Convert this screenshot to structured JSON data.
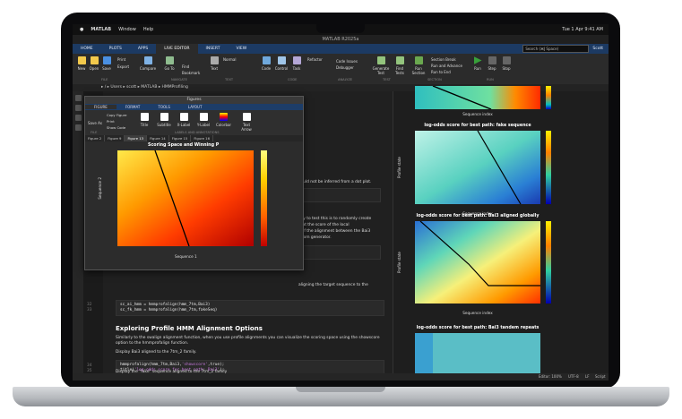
{
  "menubar": {
    "app": "MATLAB",
    "items": [
      "Window",
      "Help"
    ],
    "clock": "Tue 1 Apr  9:41 AM"
  },
  "window_title": "MATLAB R2025a",
  "tabs": [
    {
      "label": "HOME"
    },
    {
      "label": "PLOTS"
    },
    {
      "label": "APPS"
    },
    {
      "label": "LIVE EDITOR",
      "active": true
    },
    {
      "label": "INSERT"
    },
    {
      "label": "VIEW"
    }
  ],
  "search_placeholder": "Search (⌘J Space)",
  "user": "Scott",
  "toolstrip": {
    "new": "New",
    "open": "Open",
    "save": "Save",
    "print": "Print",
    "export": "Export",
    "compare": "Compare",
    "goto": "Go To",
    "find": "Find",
    "bookmark": "Bookmark",
    "text": "Text",
    "normal": "Normal",
    "code": "Code",
    "control": "Control",
    "task": "Task",
    "refactor": "Refactor",
    "code_issues": "Code Issues",
    "debugger": "Debugger",
    "generate_test": "Generate Test",
    "find_tests": "Find Tests",
    "run_section": "Run Section",
    "section_break": "Section Break",
    "run_advance": "Run and Advance",
    "run_to_end": "Run to End",
    "run": "Run",
    "step": "Step",
    "stop": "Stop",
    "sections": [
      "FILE",
      "NAVIGATE",
      "TEXT",
      "CODE",
      "ANALYZE",
      "TEST",
      "SECTION",
      "RUN"
    ]
  },
  "path": "▸ /  ▸  Users  ▸  scott  ▸  MATLAB  ▸  HMMProfiling",
  "editor": {
    "line_nums": [
      "32",
      "33",
      "34",
      "35"
    ],
    "frag1": "could not be inferred from a dot plot.",
    "frag2": "vay to test this is to randomly create",
    "frag3": "that the score of the local",
    "frag4": "s of the alignment between the Bai3",
    "frag5": "ndom generator.",
    "frag6": "aligning the target sequence to the",
    "code1a": "sc_ai_hmm = hmmprofalign(hmm_7tm,Bai3)",
    "code1b": "sc_fk_hmm = hmmprofalign(hmm_7tm,fakeSeq)",
    "heading": "Exploring Profile HMM Alignment Options",
    "para1": "Similarly to the swalign alignment function, when you use profile alignments you can visualize the scoring space using the",
    "para2": "showscore option to the hmmprofalign function.",
    "para3": "Display Bai3 aligned to the 7tm_2 family.",
    "code2a": "hmmprofalign(hmm_7tm,Bai3,",
    "code2b": "'showscore'",
    "code2c": ",true);",
    "code2d": "title(",
    "code2e": "'log-odds score for best path: Bai3'",
    "code2f": ");",
    "para4": "Display the \"fake\" sequence aligned to the 7tm_2 family"
  },
  "figure": {
    "window_title": "Figures",
    "tabs": [
      "FIGURE",
      "FORMAT",
      "TOOLS",
      "LAYOUT"
    ],
    "tools": [
      "Title",
      "Subtitle",
      "X-Label",
      "Y-Label",
      "Colorbar",
      "Text Arrow"
    ],
    "save": "Save As",
    "copy": "Copy Figure",
    "print": "Print",
    "showcode": "Show Code",
    "groups": [
      "FILE",
      "LABELS AND ANNOTATIONS"
    ],
    "doc_tabs": [
      "Figure 2",
      "Figure 9",
      "Figure 13",
      "Figure 14",
      "Figure 15",
      "Figure 16"
    ],
    "plot_title": "Scoring Space and Winning P",
    "xlabel": "Sequence 1",
    "ylabel": "Sequence 2"
  },
  "output_plots": [
    {
      "title": "",
      "xlabel": "Sequence index",
      "ylabel": ""
    },
    {
      "title": "log-odds score for best path: fake sequence",
      "xlabel": "Sequence index",
      "ylabel": "Profile state"
    },
    {
      "title": "log-odds score for best path: Bai3 aligned globally",
      "xlabel": "Sequence index",
      "ylabel": "Profile state"
    },
    {
      "title": "log-odds score for best path: Bai3 tandem repeats",
      "xlabel": "",
      "ylabel": ""
    }
  ],
  "status": {
    "zoom": "Editor: 100%",
    "encoding": "UTF-8",
    "eol": "LF",
    "type": "Script"
  },
  "colors": {
    "accent": "#1c3a63",
    "editor_bg": "#202020",
    "hot": "#ff3b00"
  }
}
